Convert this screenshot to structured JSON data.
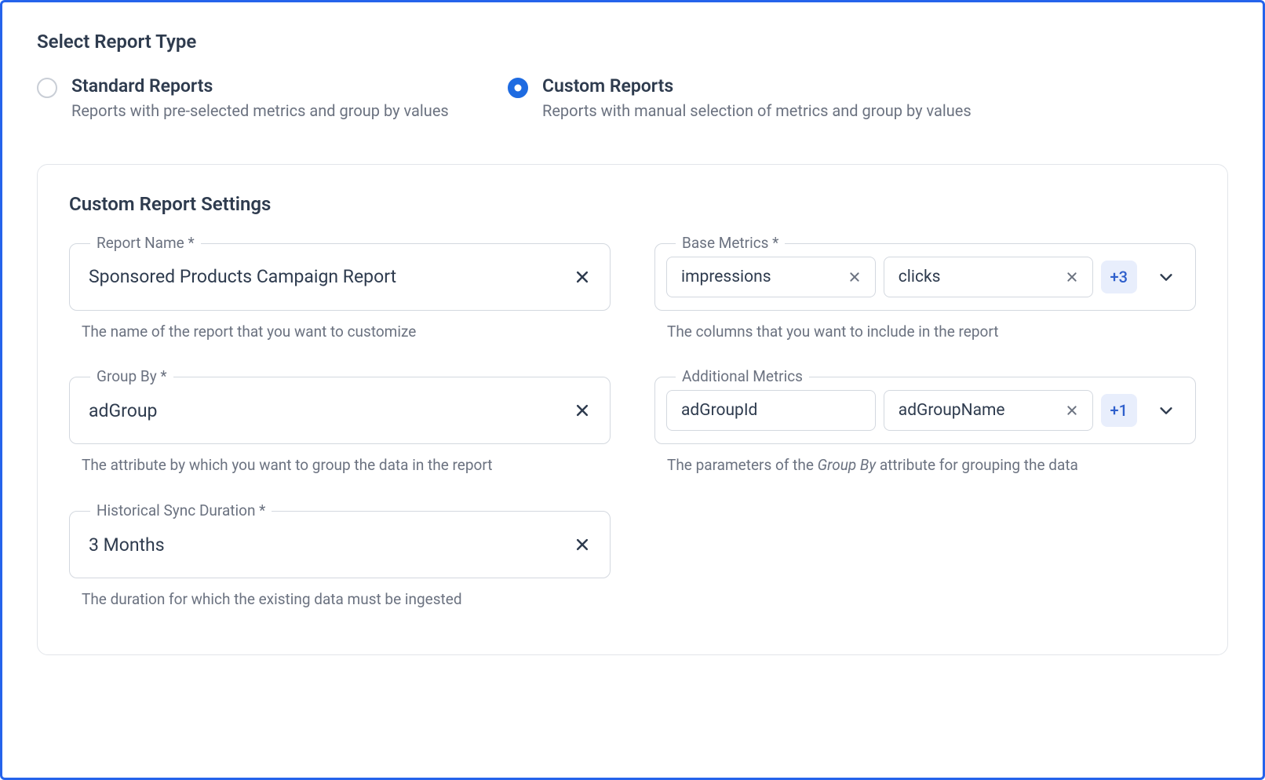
{
  "header": {
    "title": "Select Report Type"
  },
  "options": {
    "standard": {
      "title": "Standard Reports",
      "desc": "Reports with pre-selected metrics and group by values",
      "selected": false
    },
    "custom": {
      "title": "Custom Reports",
      "desc": "Reports with manual selection of metrics and group by values",
      "selected": true
    }
  },
  "panel": {
    "title": "Custom Report Settings",
    "reportName": {
      "label": "Report Name *",
      "value": "Sponsored Products Campaign Report",
      "help": "The name of the report that you want to customize"
    },
    "baseMetrics": {
      "label": "Base Metrics *",
      "chips": [
        "impressions",
        "clicks"
      ],
      "more": "+3",
      "help": "The columns that you want to include in the report"
    },
    "groupBy": {
      "label": "Group By *",
      "value": "adGroup",
      "help": "The attribute by which you want to group the data in the report"
    },
    "additionalMetrics": {
      "label": "Additional Metrics",
      "chips": [
        "adGroupId",
        "adGroupName"
      ],
      "more": "+1",
      "help_prefix": "The parameters of the ",
      "help_em": "Group By",
      "help_suffix": " attribute for grouping the data"
    },
    "historical": {
      "label": "Historical Sync Duration *",
      "value": "3 Months",
      "help": "The duration for which the existing data must be ingested"
    }
  }
}
